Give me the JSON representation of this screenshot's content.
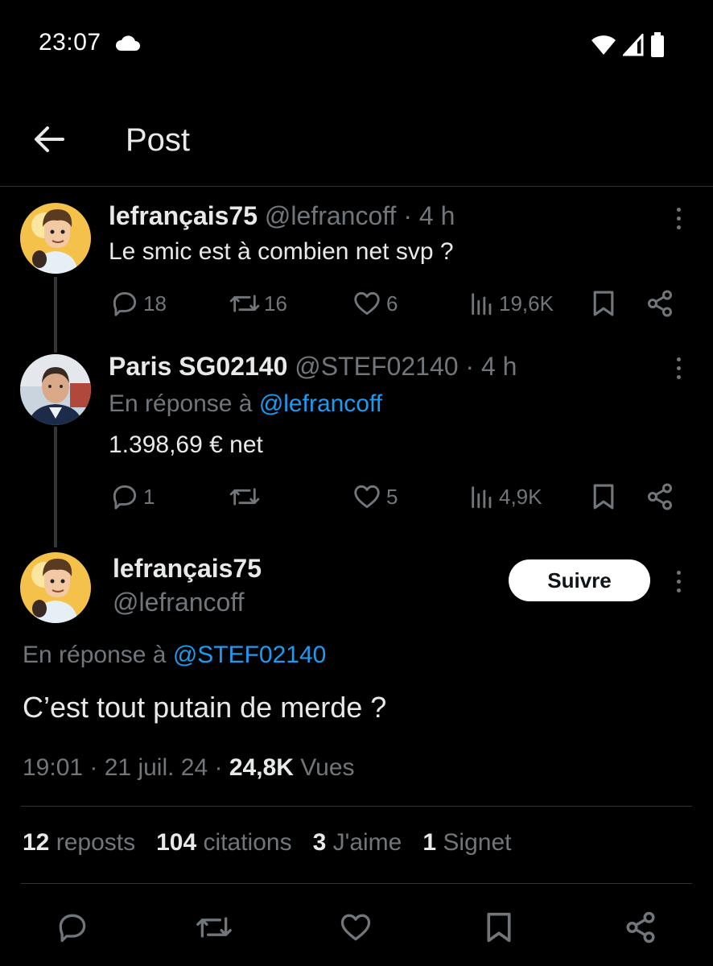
{
  "status_bar": {
    "time": "23:07",
    "icons": [
      "cloud-icon",
      "wifi-icon",
      "signal-icon",
      "battery-icon"
    ]
  },
  "header": {
    "title": "Post",
    "back_icon": "arrow-left-icon"
  },
  "tweets": [
    {
      "display_name": "lefrançais75",
      "handle": "@lefrancoff",
      "time": "· 4 h",
      "text": "Le smic est à combien net svp ?",
      "replies": "18",
      "reposts": "16",
      "likes": "6",
      "views": "19,6K"
    },
    {
      "display_name": "Paris SG02140",
      "handle": "@STEF02140",
      "time": "· 4 h",
      "reply_prefix": "En réponse à",
      "reply_to": "@lefrancoff",
      "text": "1.398,69 € net",
      "replies": "1",
      "reposts": "",
      "likes": "5",
      "views": "4,9K"
    }
  ],
  "main_post": {
    "display_name": "lefrançais75",
    "handle": "@lefrancoff",
    "follow_label": "Suivre",
    "reply_prefix": "En réponse à",
    "reply_to": "@STEF02140",
    "text": "C’est tout putain de merde ?",
    "timestamp": "19:01 · 21 juil. 24 ·",
    "views_count": "24,8K",
    "views_label": "Vues",
    "stats": {
      "reposts_count": "12",
      "reposts_label": "reposts",
      "quotes_count": "104",
      "quotes_label": "citations",
      "likes_count": "3",
      "likes_label": "J'aime",
      "bookmarks_count": "1",
      "bookmarks_label": "Signet"
    }
  },
  "colors": {
    "background": "#000000",
    "text": "#e7e9ea",
    "muted": "#71767b",
    "link": "#1d9bf0",
    "divider": "#2f3336"
  }
}
